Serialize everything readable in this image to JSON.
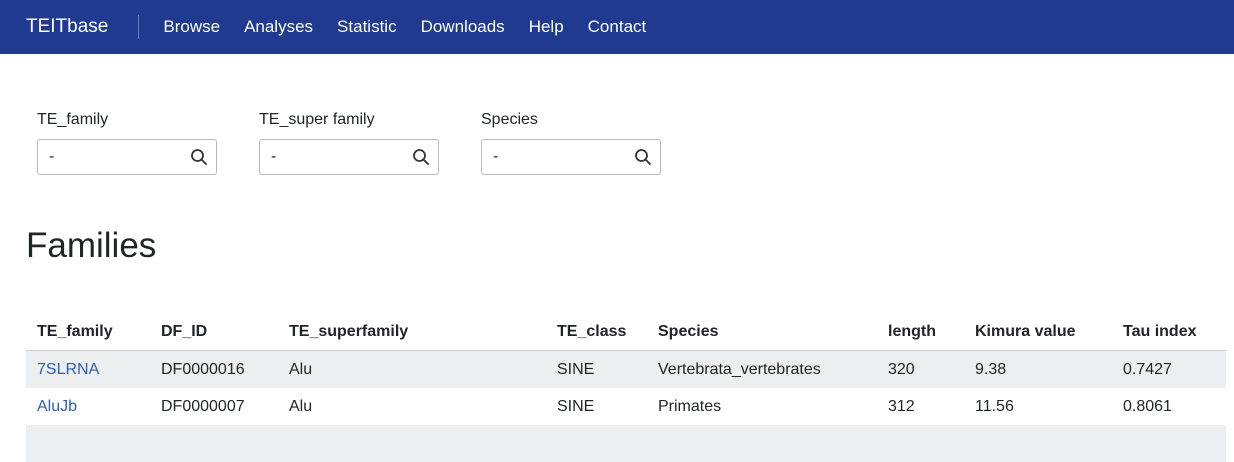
{
  "nav": {
    "brand": "TEITbase",
    "items": [
      "Browse",
      "Analyses",
      "Statistic",
      "Downloads",
      "Help",
      "Contact"
    ],
    "background_color": "#1f3a8f"
  },
  "filters": [
    {
      "label": "TE_family",
      "value": "-",
      "icon": "search-icon"
    },
    {
      "label": "TE_super family",
      "value": "-",
      "icon": "search-icon"
    },
    {
      "label": "Species",
      "value": "-",
      "icon": "search-icon"
    }
  ],
  "section_title": "Families",
  "table": {
    "columns": [
      "TE_family",
      "DF_ID",
      "TE_superfamily",
      "TE_class",
      "Species",
      "length",
      "Kimura value",
      "Tau index"
    ],
    "rows": [
      [
        "7SLRNA",
        "DF0000016",
        "Alu",
        "SINE",
        "Vertebrata_vertebrates",
        "320",
        "9.38",
        "0.7427"
      ],
      [
        "AluJb",
        "DF0000007",
        "Alu",
        "SINE",
        "Primates",
        "312",
        "11.56",
        "0.8061"
      ]
    ],
    "link_color": "#2f5fb3",
    "stripe_color": "#eceef0"
  }
}
